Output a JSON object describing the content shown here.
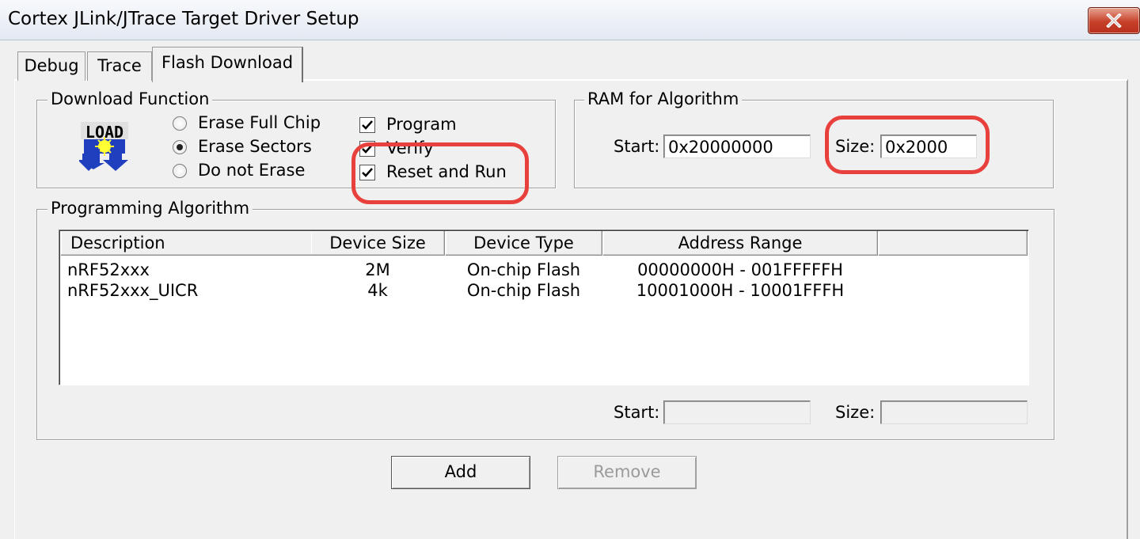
{
  "window": {
    "title": "Cortex JLink/JTrace Target Driver Setup"
  },
  "tabs": [
    {
      "label": "Debug"
    },
    {
      "label": "Trace"
    },
    {
      "label": "Flash Download",
      "selected": true
    }
  ],
  "download_function": {
    "legend": "Download Function",
    "icon_text": "LOAD",
    "erase_options": [
      {
        "label": "Erase Full Chip",
        "selected": false
      },
      {
        "label": "Erase Sectors",
        "selected": true
      },
      {
        "label": "Do not Erase",
        "selected": false
      }
    ],
    "checks": [
      {
        "label": "Program",
        "checked": true
      },
      {
        "label": "Verify",
        "checked": true
      },
      {
        "label": "Reset and Run",
        "checked": true
      }
    ]
  },
  "ram_for_algorithm": {
    "legend": "RAM for Algorithm",
    "start_label": "Start:",
    "start_value": "0x20000000",
    "size_label": "Size:",
    "size_value": "0x2000"
  },
  "programming_algorithm": {
    "legend": "Programming Algorithm",
    "columns": [
      "Description",
      "Device Size",
      "Device Type",
      "Address Range"
    ],
    "rows": [
      {
        "description": "nRF52xxx",
        "device_size": "2M",
        "device_type": "On-chip Flash",
        "address_range": "00000000H - 001FFFFFH"
      },
      {
        "description": "nRF52xxx_UICR",
        "device_size": "4k",
        "device_type": "On-chip Flash",
        "address_range": "10001000H - 10001FFFH"
      }
    ],
    "start_label": "Start:",
    "start_value": "",
    "size_label": "Size:",
    "size_value": ""
  },
  "buttons": {
    "add": "Add",
    "remove": "Remove"
  },
  "colors": {
    "highlight": "#e8413d",
    "window_bg": "#f0f0f0"
  }
}
